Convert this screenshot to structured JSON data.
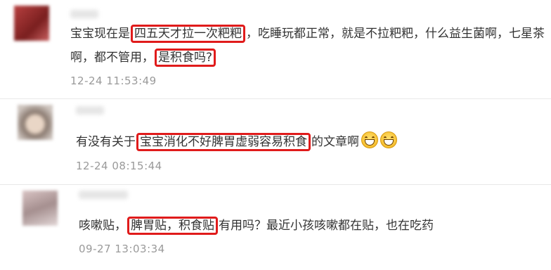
{
  "comments": [
    {
      "avatar": "blurred-avatar",
      "line1": {
        "pre": "宝宝现在是",
        "hl1": "四五天才拉一次粑粑",
        "post": "，吃睡玩都正常，就是不拉粑粑，什么益生菌啊，七星茶"
      },
      "line2": {
        "pre": "啊，都不管用，",
        "hl1": "是积食吗?"
      },
      "time": "12-24 11:53:49"
    },
    {
      "avatar": "blurred-avatar",
      "line1": {
        "pre": "有没有关于",
        "hl1": "宝宝消化不好脾胃虚弱容易积食",
        "post": "的文章啊"
      },
      "emojis": [
        "grin-emoji",
        "grin-emoji"
      ],
      "time": "12-24 08:15:44"
    },
    {
      "avatar": "blurred-avatar",
      "line1": {
        "pre": "咳嗽贴，",
        "hl1": "脾胃贴，积食贴",
        "post": "有用吗？最近小孩咳嗽都在贴，也在吃药"
      },
      "time": "09-27 13:03:34"
    }
  ],
  "colors": {
    "highlight": "#e01b1b",
    "text": "#333333",
    "timestamp": "#9a9a9a"
  }
}
